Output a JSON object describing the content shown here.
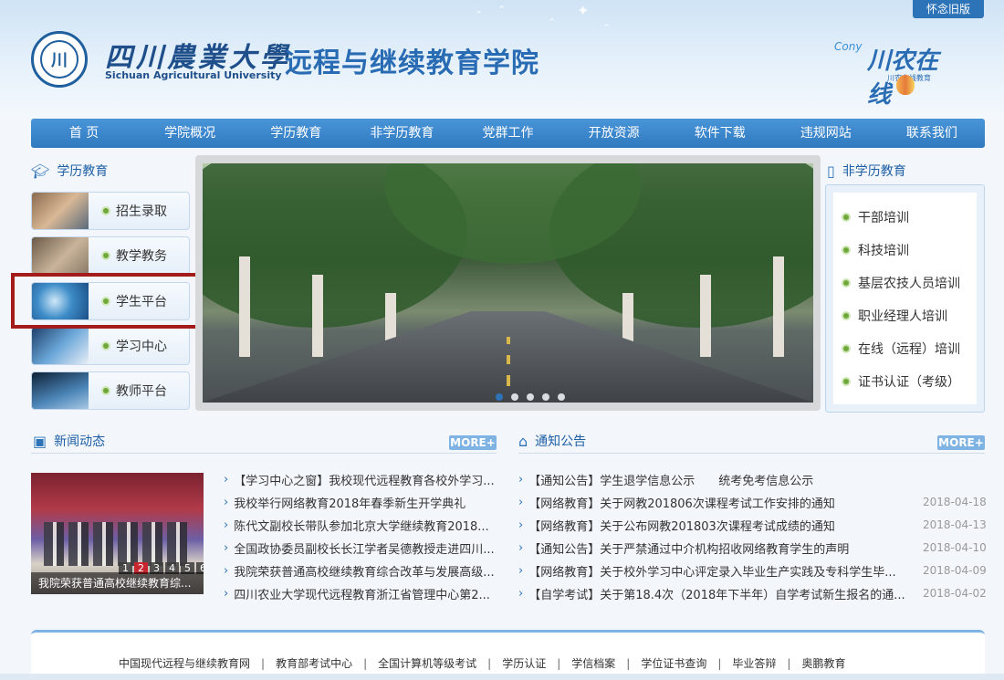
{
  "header": {
    "old_version": "怀念旧版",
    "seal_char": "川",
    "university_cn": "四川農業大學",
    "university_en": "Sichuan Agricultural University",
    "college_name": "远程与继续教育学院",
    "online_logo": "川农在线",
    "online_logo_prefix": "Cony",
    "online_logo_sub": "川农在线教育"
  },
  "nav": {
    "items": [
      "首 页",
      "学院概况",
      "学历教育",
      "非学历教育",
      "党群工作",
      "开放资源",
      "软件下载",
      "违规网站",
      "联系我们"
    ]
  },
  "left": {
    "title": "学历教育",
    "items": [
      "招生录取",
      "教学教务",
      "学生平台",
      "学习中心",
      "教师平台"
    ]
  },
  "right": {
    "title": "非学历教育",
    "items": [
      "干部培训",
      "科技培训",
      "基层农技人员培训",
      "职业经理人培训",
      "在线（远程）培训",
      "证书认证（考级）"
    ]
  },
  "banner": {
    "dot_count": 5,
    "active_index": 0
  },
  "news": {
    "title": "新闻动态",
    "more": "MORE+",
    "photo_caption": "我院荣获普通高校继续教育综...",
    "pager": [
      "1",
      "2",
      "3",
      "4",
      "5",
      "6"
    ],
    "pager_active": 1,
    "items": [
      "【学习中心之窗】我校现代远程教育各校外学习...",
      "我校举行网络教育2018年春季新生开学典礼",
      "陈代文副校长带队参加北京大学继续教育2018...",
      "全国政协委员副校长长江学者吴德教授走进四川...",
      "我院荣获普通高校继续教育综合改革与发展高级...",
      "四川农业大学现代远程教育浙江省管理中心第2..."
    ]
  },
  "notice": {
    "title": "通知公告",
    "more": "MORE+",
    "items": [
      {
        "text": "【通知公告】学生退学信息公示　　统考免考信息公示",
        "date": ""
      },
      {
        "text": "【网络教育】关于网教201806次课程考试工作安排的通知",
        "date": "2018-04-18"
      },
      {
        "text": "【网络教育】关于公布网教201803次课程考试成绩的通知",
        "date": "2018-04-13"
      },
      {
        "text": "【通知公告】关于严禁通过中介机构招收网络教育学生的声明",
        "date": "2018-04-10"
      },
      {
        "text": "【网络教育】关于校外学习中心评定录入毕业生产实践及专科学生毕...",
        "date": "2018-04-09"
      },
      {
        "text": "【自学考试】关于第18.4次（2018年下半年）自学考试新生报名的通...",
        "date": "2018-04-02"
      }
    ]
  },
  "footer": {
    "links": [
      "中国现代远程与继续教育网",
      "教育部考试中心",
      "全国计算机等级考试",
      "学历认证",
      "学信档案",
      "学位证书查询",
      "毕业答辩",
      "奥鹏教育"
    ]
  }
}
